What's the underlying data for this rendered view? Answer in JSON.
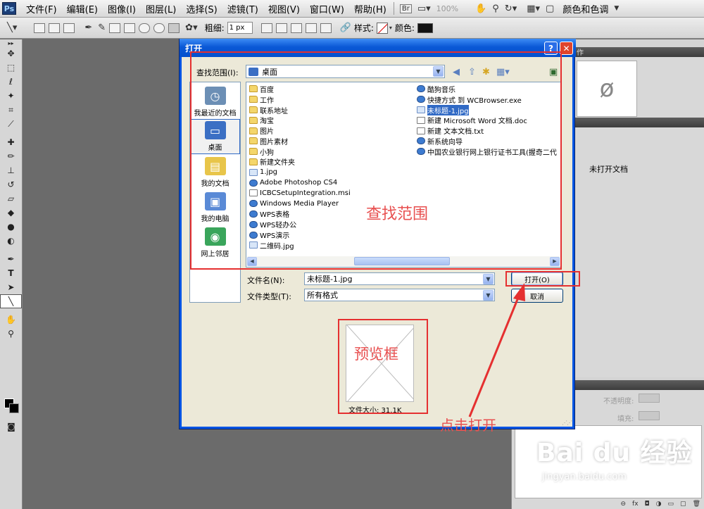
{
  "menubar": {
    "logo": "Ps",
    "items": [
      "文件(F)",
      "编辑(E)",
      "图像(I)",
      "图层(L)",
      "选择(S)",
      "滤镜(T)",
      "视图(V)",
      "窗口(W)",
      "帮助(H)"
    ],
    "bridge": "Br",
    "zoom": "100%",
    "workspace": "颜色和色调"
  },
  "options": {
    "weight_label": "粗细:",
    "weight_value": "1 px",
    "style_label": "样式:",
    "color_label": "颜色:",
    "accent_color": "#111111"
  },
  "panels": {
    "tab_fragment": "作",
    "nav_glyph": "ø",
    "no_document": "未打开文档",
    "opacity_label": "不透明度:",
    "fill_label": "填充:",
    "footer_icons": [
      "fx"
    ]
  },
  "dialog": {
    "title": "打开",
    "help_btn": "?",
    "close_btn": "✕",
    "look_in_label": "查找范围(I):",
    "look_in_value": "桌面",
    "places": [
      {
        "label": "我最近的文档",
        "icon": "recent-documents-icon",
        "color": "#6c8fb5"
      },
      {
        "label": "桌面",
        "icon": "desktop-icon",
        "color": "#3b6fc4"
      },
      {
        "label": "我的文档",
        "icon": "my-documents-icon",
        "color": "#e8c54a"
      },
      {
        "label": "我的电脑",
        "icon": "my-computer-icon",
        "color": "#5a8ad6"
      },
      {
        "label": "网上邻居",
        "icon": "network-places-icon",
        "color": "#3aa55b"
      }
    ],
    "files_col1": [
      {
        "name": "百度",
        "type": "folder"
      },
      {
        "name": "工作",
        "type": "folder"
      },
      {
        "name": "联系地址",
        "type": "folder"
      },
      {
        "name": "淘宝",
        "type": "folder"
      },
      {
        "name": "图片",
        "type": "folder"
      },
      {
        "name": "图片素材",
        "type": "folder"
      },
      {
        "name": "小狗",
        "type": "folder"
      },
      {
        "name": "新建文件夹",
        "type": "folder"
      },
      {
        "name": "1.jpg",
        "type": "img"
      },
      {
        "name": "Adobe Photoshop CS4",
        "type": "app"
      },
      {
        "name": "ICBCSetupIntegration.msi",
        "type": "doc"
      },
      {
        "name": "Windows Media Player",
        "type": "app"
      },
      {
        "name": "WPS表格",
        "type": "app"
      },
      {
        "name": "WPS轻办公",
        "type": "app"
      },
      {
        "name": "WPS演示",
        "type": "app"
      },
      {
        "name": "二维码.jpg",
        "type": "img"
      }
    ],
    "files_col2": [
      {
        "name": "酷狗音乐",
        "type": "app"
      },
      {
        "name": "快捷方式 到 WCBrowser.exe",
        "type": "app"
      },
      {
        "name": "未标题-1.jpg",
        "type": "img",
        "selected": true
      },
      {
        "name": "新建 Microsoft Word 文档.doc",
        "type": "doc"
      },
      {
        "name": "新建 文本文档.txt",
        "type": "doc"
      },
      {
        "name": "新系统向导",
        "type": "app"
      },
      {
        "name": "中国农业银行网上银行证书工具(握奇二代",
        "type": "app"
      }
    ],
    "filename_label": "文件名(N):",
    "filename_value": "未标题-1.jpg",
    "filetype_label": "文件类型(T):",
    "filetype_value": "所有格式",
    "open_button": "打开(O)",
    "cancel_button": "取消",
    "file_size": "文件大小: 31.1K"
  },
  "annotations": {
    "lookin_area": "查找范围",
    "preview": "预览框",
    "click_open": "点击打开",
    "color": "#e53030"
  },
  "watermark": {
    "brand": "Bai du 经验",
    "url": "jingyan.baidu.com"
  }
}
